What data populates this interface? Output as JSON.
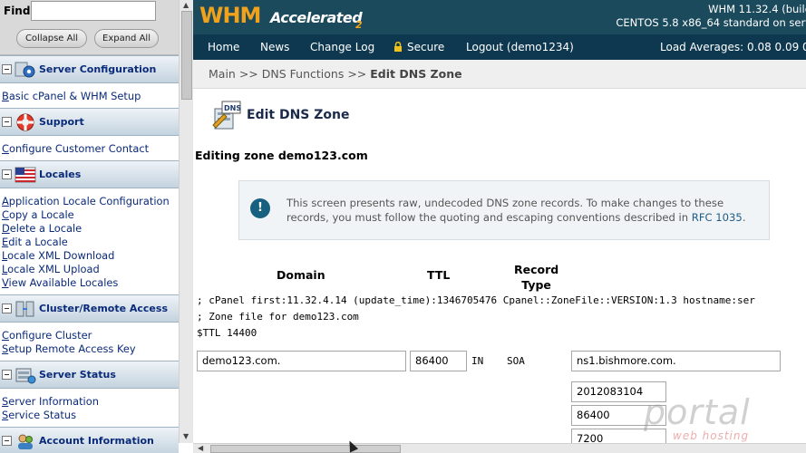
{
  "sidebar": {
    "find_label": "Find",
    "find_value": "",
    "collapse_all": "Collapse All",
    "expand_all": "Expand All",
    "sections": [
      {
        "title": "Server Configuration",
        "icon": "gear-icon",
        "links": [
          "Basic cPanel & WHM Setup"
        ]
      },
      {
        "title": "Support",
        "icon": "lifebuoy-icon",
        "links": [
          "Configure Customer Contact"
        ]
      },
      {
        "title": "Locales",
        "icon": "flag-icon",
        "links": [
          "Application Locale Configuration",
          "Copy a Locale",
          "Delete a Locale",
          "Edit a Locale",
          "Locale XML Download",
          "Locale XML Upload",
          "View Available Locales"
        ]
      },
      {
        "title": "Cluster/Remote Access",
        "icon": "server-cluster-icon",
        "links": [
          "Configure Cluster",
          "Setup Remote Access Key"
        ]
      },
      {
        "title": "Server Status",
        "icon": "server-status-icon",
        "links": [
          "Server Information",
          "Service Status"
        ]
      },
      {
        "title": "Account Information",
        "icon": "users-icon",
        "links": []
      }
    ]
  },
  "header": {
    "logo_main": "WHM",
    "logo_sub": "Accelerated",
    "logo_num": "2",
    "version_line1": "WHM 11.32.4 (build",
    "version_line2": "CENTOS 5.8 x86_64 standard on serv"
  },
  "nav": {
    "home": "Home",
    "news": "News",
    "change_log": "Change Log",
    "secure": "Secure",
    "logout": "Logout (demo1234)",
    "load": "Load Averages: 0.08 0.09 0"
  },
  "breadcrumb": {
    "main": "Main",
    "sep1": ">>",
    "dns_functions": "DNS Functions",
    "sep2": ">>",
    "current": "Edit DNS Zone"
  },
  "page": {
    "title": "Edit DNS Zone",
    "zone_line": "Editing zone demo123.com"
  },
  "notice": {
    "text_before": "This screen presents raw, undecoded DNS zone records. To make changes to these records, you must follow the quoting and escaping conventions described in ",
    "link": "RFC 1035",
    "text_after": "."
  },
  "table": {
    "col_domain": "Domain",
    "col_ttl": "TTL",
    "col_record_type_1": "Record",
    "col_record_type_2": "Type",
    "comments": [
      "; cPanel first:11.32.4.14 (update_time):1346705476 Cpanel::ZoneFile::VERSION:1.3 hostname:ser",
      "; Zone file for demo123.com",
      "$TTL 14400"
    ],
    "row": {
      "domain": "demo123.com.",
      "ttl": "86400",
      "class": "IN",
      "type": "SOA",
      "primary_ns": "ns1.bishmore.com.",
      "serial": "2012083104",
      "refresh": "86400",
      "retry": "7200"
    }
  },
  "watermark": {
    "main": "portal",
    "sub": "web hosting"
  },
  "colors": {
    "header_bg": "#1b4a5d",
    "nav_bg": "#0d3850",
    "logo_orange": "#f1a21b",
    "link_blue": "#0a2a7a"
  }
}
